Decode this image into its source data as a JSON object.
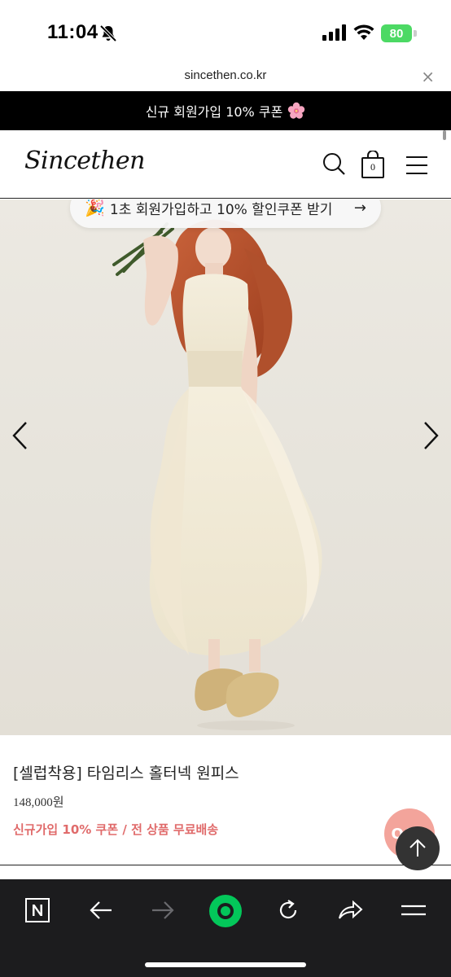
{
  "status_bar": {
    "time": "11:04",
    "battery": "80"
  },
  "browser": {
    "url": "sincethen.co.kr",
    "close_label": "×"
  },
  "promo_banner": {
    "text": "신규 회원가입 10% 쿠폰"
  },
  "header": {
    "logo": "Sincethen",
    "cart_count": "0"
  },
  "hero": {
    "coupon_text": "1초 회원가입하고 10% 할인쿠폰 받기",
    "coupon_arrow": "→"
  },
  "product": {
    "name": "[셀럽착용] 타임리스 홀터넥 원피스",
    "price": "148,000원",
    "promo": "신규가입 10% 쿠폰 / 전 상품 무료배송",
    "qna_label": "Q&A"
  },
  "toolbar": {
    "items": [
      "naver-home",
      "back",
      "forward",
      "green-dot",
      "refresh",
      "share",
      "menu"
    ]
  },
  "colors": {
    "accent_promo": "#e06b6b",
    "green": "#03c75a",
    "battery": "#4cd964"
  }
}
